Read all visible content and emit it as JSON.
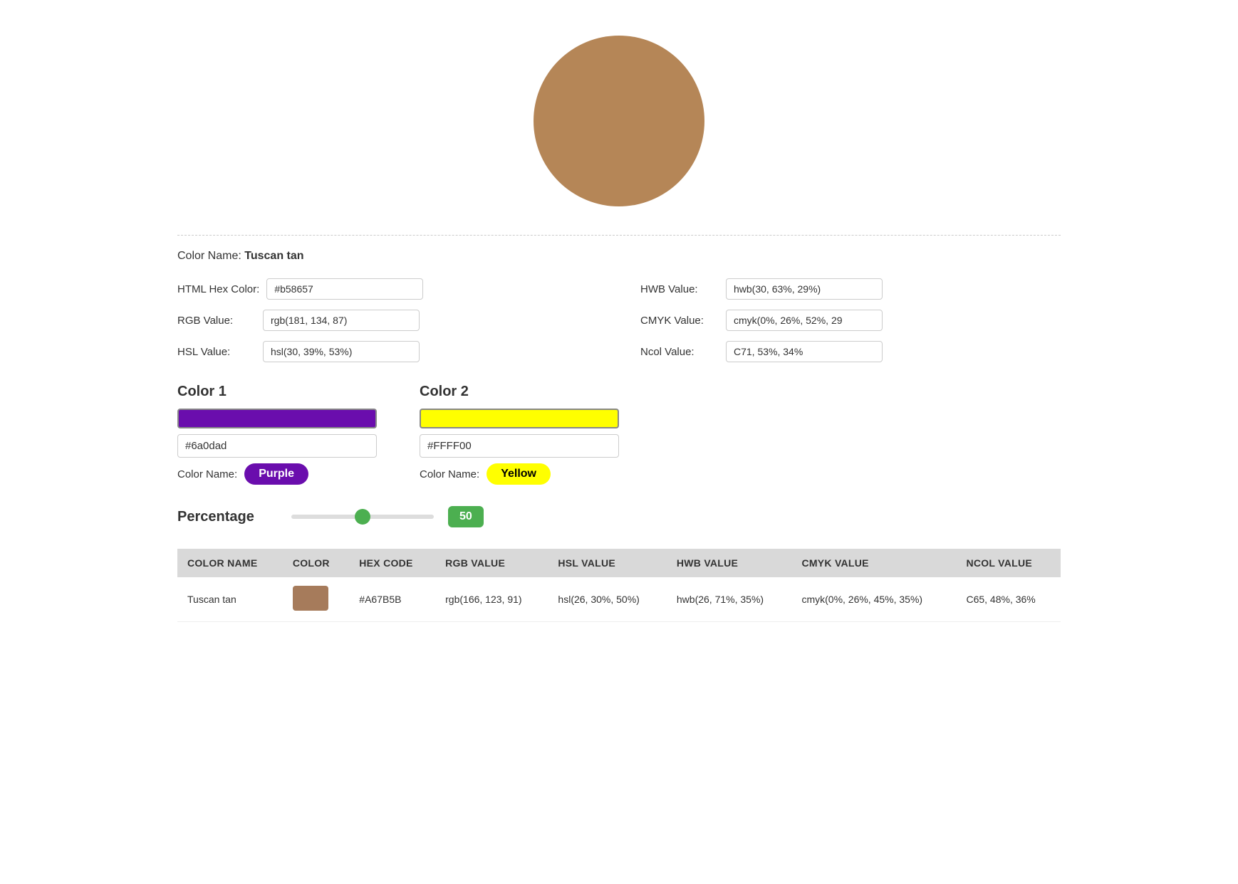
{
  "circle": {
    "color": "#b58657"
  },
  "colorInfo": {
    "name_label": "Color Name:",
    "name_value": "Tuscan tan",
    "fields_left": [
      {
        "label": "HTML Hex Color:",
        "value": "#b58657"
      },
      {
        "label": "RGB Value:",
        "value": "rgb(181, 134, 87)"
      },
      {
        "label": "HSL Value:",
        "value": "hsl(30, 39%, 53%)"
      }
    ],
    "fields_right": [
      {
        "label": "HWB Value:",
        "value": "hwb(30, 63%, 29%)"
      },
      {
        "label": "CMYK Value:",
        "value": "cmyk(0%, 26%, 52%, 29"
      },
      {
        "label": "Ncol Value:",
        "value": "C71, 53%, 34%"
      }
    ]
  },
  "color1": {
    "heading": "Color 1",
    "bar_color": "#6a0dad",
    "hex_value": "#6a0dad",
    "name_label": "Color Name:",
    "name_value": "Purple",
    "badge_bg": "#6a0dad",
    "badge_text_color": "#fff"
  },
  "color2": {
    "heading": "Color 2",
    "bar_color": "#FFFF00",
    "hex_value": "#FFFF00",
    "name_label": "Color Name:",
    "name_value": "Yellow",
    "badge_bg": "#FFFF00",
    "badge_text_color": "#000"
  },
  "percentage": {
    "heading": "Percentage",
    "slider_value": 50,
    "slider_min": 0,
    "slider_max": 100
  },
  "table": {
    "headers": [
      "COLOR NAME",
      "COLOR",
      "HEX CODE",
      "RGB VALUE",
      "HSL VALUE",
      "HWB VALUE",
      "CMYK VALUE",
      "NCOL VALUE"
    ],
    "rows": [
      {
        "name": "Tuscan tan",
        "color": "#A67B5B",
        "hex": "#A67B5B",
        "rgb": "rgb(166, 123, 91)",
        "hsl": "hsl(26, 30%, 50%)",
        "hwb": "hwb(26, 71%, 35%)",
        "cmyk": "cmyk(0%, 26%, 45%, 35%)",
        "ncol": "C65, 48%, 36%"
      }
    ]
  }
}
